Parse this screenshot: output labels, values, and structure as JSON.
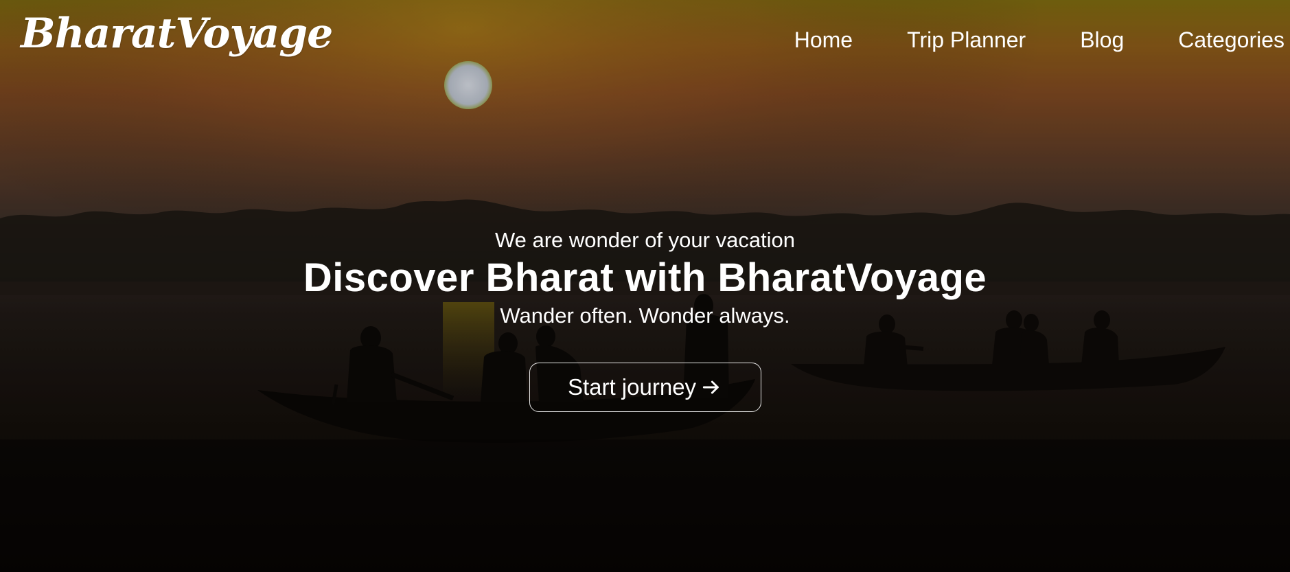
{
  "brand": {
    "logo_text": "BharatVoyage"
  },
  "nav": {
    "items": [
      {
        "label": "Home"
      },
      {
        "label": "Trip Planner"
      },
      {
        "label": "Blog"
      },
      {
        "label": "Categories"
      }
    ]
  },
  "hero": {
    "tagline": "We are wonder of your vacation",
    "headline": "Discover Bharat with BharatVoyage",
    "subline": "Wander often. Wonder always.",
    "cta_label": "Start journey",
    "cta_icon": "arrow-right-icon",
    "background": "sunset-river-boats-photo"
  },
  "colors": {
    "text": "#ffffff",
    "sky_top": "#9a7a12",
    "sky_mid": "#8a4a1f",
    "water_dark": "#0c0805",
    "sun": "#c9cfd9"
  }
}
